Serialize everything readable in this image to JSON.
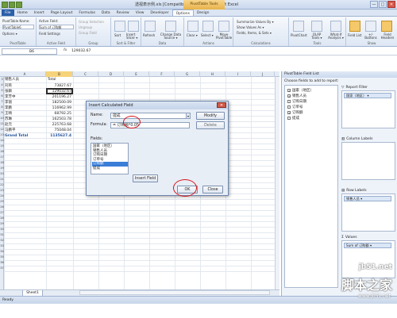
{
  "window": {
    "title": "透视表示例.xls [Compatibility Mode] - Microsoft Excel",
    "context_tab": "PivotTable Tools",
    "buttons": [
      "—",
      "□",
      "✕"
    ]
  },
  "ribbon_tabs": [
    "File",
    "Home",
    "Insert",
    "Page Layout",
    "Formulas",
    "Data",
    "Review",
    "View",
    "Developer",
    "Options",
    "Design"
  ],
  "ribbon": {
    "pivottable": {
      "name_label": "PivotTable Name:",
      "name_value": "PivotTable6",
      "options_label": "Options ▾",
      "group": "PivotTable"
    },
    "active_field": {
      "label": "Active Field:",
      "value": "Sum of 订购额",
      "settings": "Field Settings",
      "group": "Active Field"
    },
    "group": {
      "selection": "Group Selection",
      "ungroup": "Ungroup",
      "field": "Group Field",
      "group": "Group"
    },
    "sort": {
      "sort": "Sort",
      "slicer": "Insert Slicer ▾",
      "group": "Sort & Filter"
    },
    "data": {
      "refresh": "Refresh",
      "change_source": "Change Data Source ▾",
      "group": "Data"
    },
    "actions": {
      "clear": "Clear ▾",
      "select": "Select ▾",
      "move": "Move PivotTable",
      "group": "Actions"
    },
    "calc": {
      "summarize": "Summarize Values By ▾",
      "show": "Show Values As ▾",
      "fields": "Fields, Items, & Sets ▾",
      "group": "Calculations"
    },
    "tools": {
      "chart": "PivotChart",
      "olap": "OLAP Tools ▾",
      "whatif": "What-If Analysis ▾",
      "group": "Tools"
    },
    "show": {
      "list": "Field List",
      "buttons": "+/- Buttons",
      "headers": "Field Headers",
      "group": "Show"
    }
  },
  "formula_bar": {
    "name_box": "B6",
    "fx": "fx",
    "value": "129032.67"
  },
  "columns": [
    "A",
    "B",
    "C",
    "D",
    "E",
    "F",
    "G",
    "H",
    "I",
    "J"
  ],
  "rows": [
    "3",
    "4",
    "5",
    "6",
    "7",
    "8",
    "9",
    "10",
    "11",
    "12",
    "13",
    "14",
    "15",
    "16",
    "17",
    "18",
    "19",
    "20",
    "21",
    "22",
    "23",
    "24",
    "25",
    "26",
    "27",
    "28",
    "29",
    "30",
    "31",
    "32",
    "33",
    "34",
    "35",
    "36",
    "37"
  ],
  "pivot": {
    "header_a": "销售人员",
    "header_b": "Total",
    "names": [
      "刘英",
      "张颖",
      "李芳中",
      "李丽",
      "李鹏",
      "王晴",
      "苏琳",
      "赵元",
      "马鹏平",
      "Grand Total"
    ],
    "values": [
      "73827.67",
      "129032.67",
      "201196.27",
      "182500.09",
      "116962.99",
      "68792.25",
      "162503.78",
      "225763.68",
      "75048.04",
      "1135627.4"
    ]
  },
  "sheet_tab": "Sheet1",
  "status": {
    "ready": "Ready"
  },
  "field_list": {
    "title": "PivotTable Field List",
    "choose": "Choose fields to add to report:",
    "fields": [
      {
        "name": "国家（地区）",
        "checked": true
      },
      {
        "name": "销售人员",
        "checked": true
      },
      {
        "name": "订购日期",
        "checked": false
      },
      {
        "name": "订单号",
        "checked": false
      },
      {
        "name": "订购额",
        "checked": true
      },
      {
        "name": "提成",
        "checked": false
      }
    ],
    "areas": {
      "report_filter": {
        "label": "Report Filter",
        "chip": "国家（地区） ▾"
      },
      "column_labels": {
        "label": "Column Labels"
      },
      "row_labels": {
        "label": "Row Labels",
        "chip": "销售人员 ▾"
      },
      "values": {
        "label": "Values",
        "chip": "Sum of 订购额 ▾"
      }
    }
  },
  "dialog": {
    "title": "Insert Calculated Field",
    "name_label": "Name:",
    "name_value": "提成",
    "formula_label": "Formula:",
    "formula_value": "= 订购额*0.05",
    "modify": "Modify",
    "delete": "Delete",
    "fields_label": "Fields:",
    "fields": [
      "国家（地区）",
      "销售人员",
      "订购日期",
      "订单号",
      "订购额",
      "提成"
    ],
    "selected_index": 4,
    "insert_field": "Insert Field",
    "ok": "OK",
    "close": "Close"
  },
  "watermark": {
    "domain": "jb51.net",
    "brand": "脚本之家",
    "sub": "www.jb51.net"
  },
  "colors": {
    "accent": "#2a5fa8",
    "context": "#e8b24a",
    "selection": "#3a7ed8",
    "annotation": "#d8141a"
  }
}
